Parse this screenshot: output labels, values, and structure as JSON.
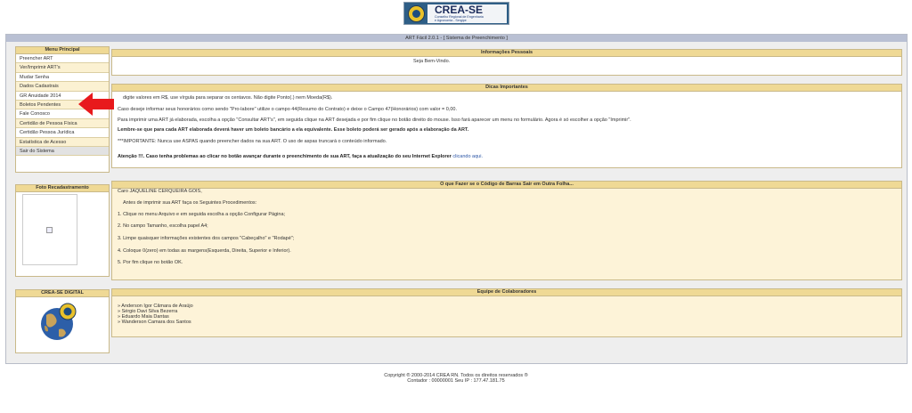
{
  "logo": {
    "main": "CREA-SE",
    "sub1": "Conselho Regional de Engenharia",
    "sub2": "e Agronomia - Sergipe"
  },
  "app": {
    "title": "ART Fácil 2.0.1 - [ Sistema de Preenchimento ]"
  },
  "menu": {
    "title": "Menu Principal",
    "items": [
      "Preencher ART",
      "Ver/Imprimir ART's",
      "Mudar Senha",
      "Dados Cadastrais",
      "GR Anuidade 2014",
      "Boletos Pendentes",
      "Fale Conosco",
      "Certidão de Pessoa Física",
      "Certidão Pessoa Jurídica",
      "Estatística de Acesso",
      "Sair do Sistema"
    ]
  },
  "foto": {
    "title": "Foto Recadastramento"
  },
  "digital": {
    "title": "CREA-SE DIGITAL"
  },
  "info": {
    "title": "Informações Pessoais",
    "welcome": "Seja Bem-Vindo."
  },
  "dicas": {
    "title": "Dicas Importantes",
    "l1": "digite valores em R$, use vírgula para separar os centavos. Não digite Ponto(.) nem Moeda(R$).",
    "l2": "Caso deseje informar seus honorários como sendo \"Pro-labore\" utilize o campo 44(Resumo do Contrato) e deixe o Campo 47(Honorários) com valor = 0,00.",
    "l3": "Para imprimir uma ART já elaborada, escolha a opção \"Consultar ART's\", em seguida clique na ART desejada e por fim clique no botão direito do mouse. Isso fará aparecer um menu no formulário. Agora é só escolher a opção \"Imprimir\".",
    "l4": "Lembre-se que para cada ART elaborada deverá haver um boleto bancário a ela equivalente. Esse boleto poderá ser gerado após a elaboração da ART.",
    "l5": "***IMPORTANTE: Nunca use ASPAS quando preencher dados na sua ART. O uso de aspas truncará o conteúdo informado.",
    "l6a": "Atenção !!!. Caso tenha problemas ao clicar no botão avançar durante o preenchimento de sua ART, faça a atualização do seu Internet Explorer",
    "l6b": "clicando aqui."
  },
  "barcode": {
    "title": "O que Fazer se o Código de Barras Sair em Outra Folha...",
    "greeting": "Caro JAQUELINE CERQUEIRA GOIS,",
    "intro": "Antes de imprimir sua ART faça os Seguintes Procedimentos:",
    "s1": "1. Clique no menu Arquivo e em seguida escolha a opção Configurar Página;",
    "s2": "2. No campo Tamanho, escolha papel A4;",
    "s3": "3. Limpe quaisquer informações existentes dos campos \"Cabeçalho\" e \"Rodapé\";",
    "s4": "4. Coloque 0(zero) em todas as margens(Esquerda, Direita, Superior e Inferior).",
    "s5": "5. Por fim clique no botão OK."
  },
  "equipe": {
    "title": "Equipe de Colaboradores",
    "members": [
      "» Anderson Igor Câmara de Araújo",
      "» Sérgio Davi Silva Bezerra",
      "» Eduardo Maia Dantas",
      "» Wanderson Camara dos Santos"
    ]
  },
  "footer": {
    "copyright": "Copyright ® 2000-2014 CREA RN. Todos os direitos reservados ®",
    "contador": "Contador : 00000001 Seu IP : 177.47.181.75"
  },
  "colors": {
    "header": "#efd995",
    "alt_row": "#fbf1d2",
    "topbar": "#b9c0d3",
    "arrow": "#e8191c"
  }
}
